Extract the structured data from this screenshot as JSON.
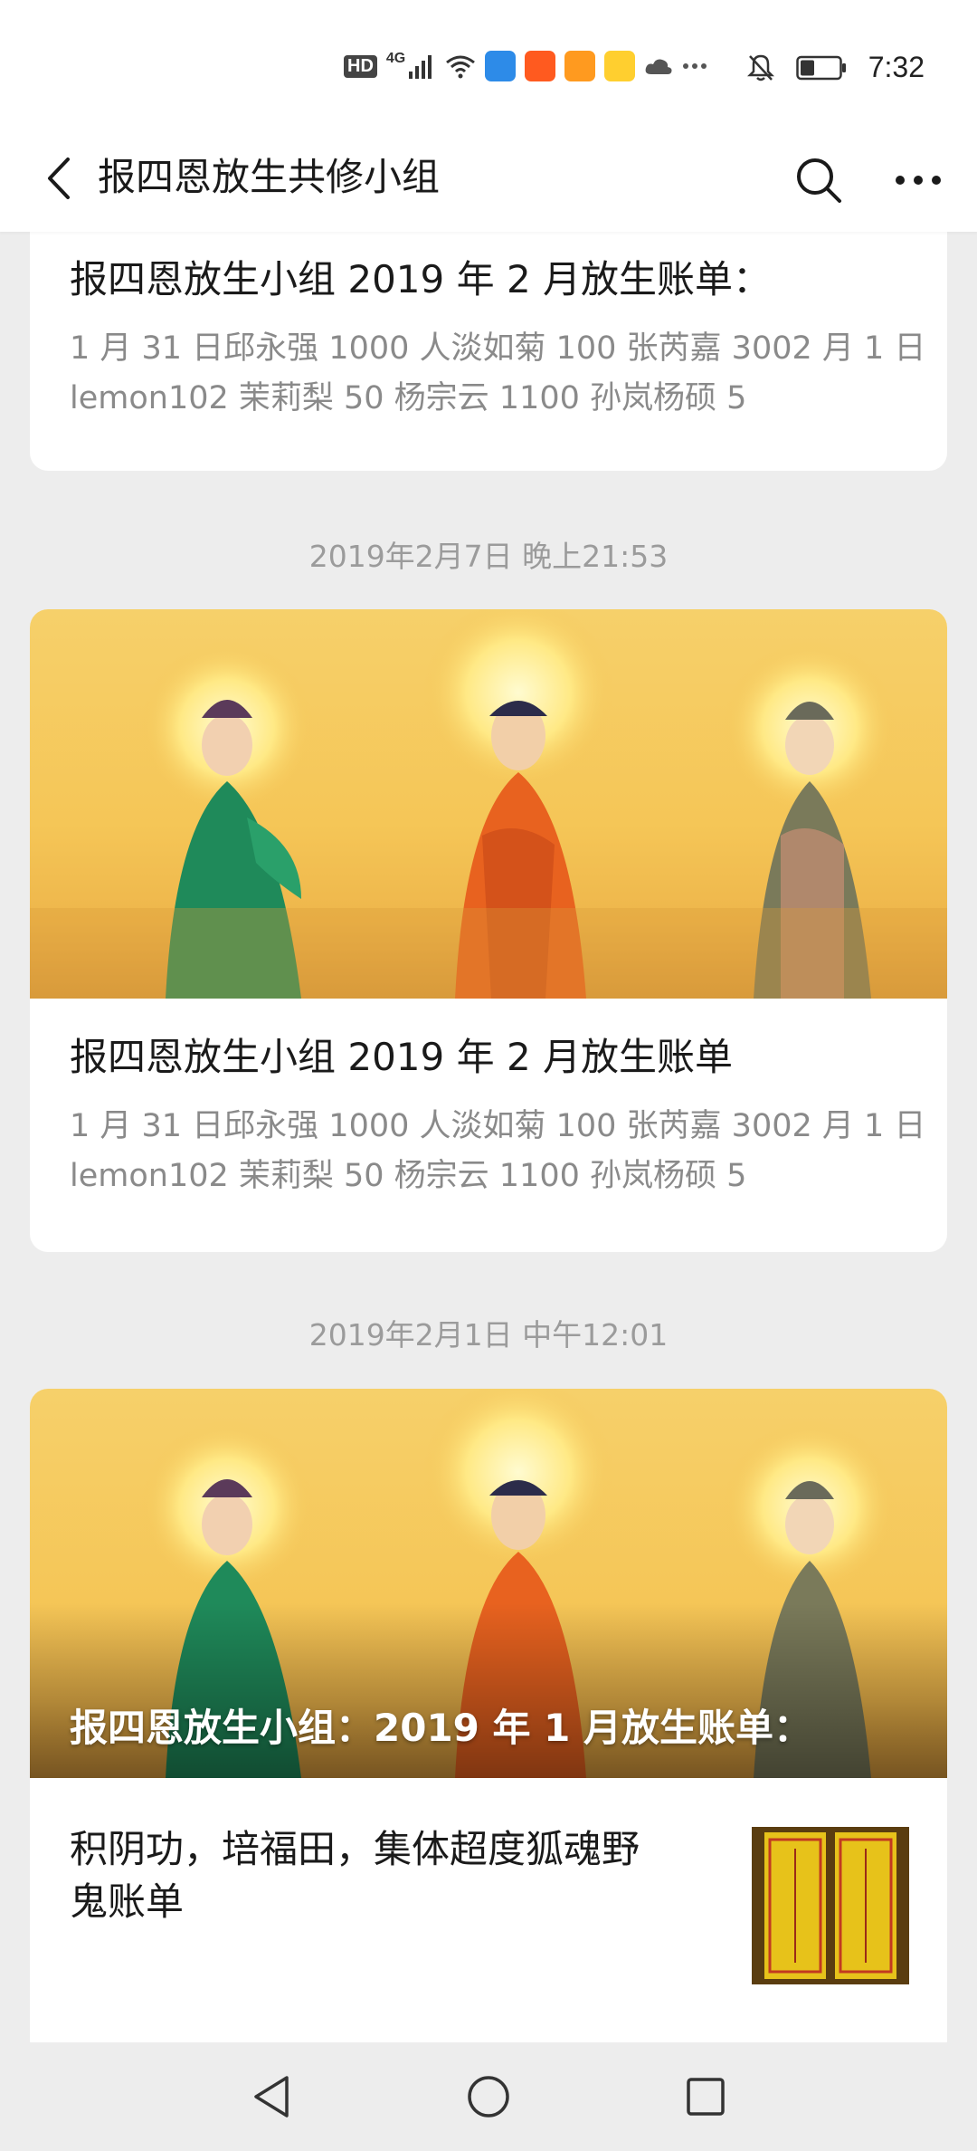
{
  "status_bar": {
    "time": "7:32",
    "network_label": "HD",
    "network_type": "4G",
    "icons": [
      "signal-icon",
      "wifi-icon",
      "app-icon",
      "taobao-icon",
      "app-icon",
      "app-icon",
      "cloud-icon",
      "more-dots-icon"
    ],
    "right_icons": [
      "bell-muted-icon",
      "battery-icon"
    ]
  },
  "header": {
    "title": "报四恩放生共修小组",
    "back_icon": "chevron-left-icon",
    "search_icon": "search-icon",
    "more_icon": "more-dots-icon"
  },
  "messages": [
    {
      "title": "报四恩放生小组 2019 年 2 月放生账单：",
      "desc_line1": "1 月 31 日邱永强 1000 人淡如菊 100 张芮嘉 3002 月 1 日",
      "desc_line2": "lemon102 茉莉梨 50 杨宗云 1100 孙岚杨硕 5"
    },
    {
      "timestamp": "2019年2月7日 晚上21:53",
      "title": "报四恩放生小组 2019 年 2 月放生账单",
      "desc_line1": "1 月 31 日邱永强 1000 人淡如菊 100 张芮嘉 3002 月 1 日",
      "desc_line2": "lemon102 茉莉梨 50 杨宗云 1100 孙岚杨硕 5"
    },
    {
      "timestamp": "2019年2月1日 中午12:01",
      "cover_title": "报四恩放生小组：2019 年 1 月放生账单：",
      "sub_title_line1": "积阴功，培福田，集体超度狐魂野",
      "sub_title_line2": "鬼账单"
    }
  ],
  "nav_bar": {
    "back_icon": "triangle-back-icon",
    "home_icon": "circle-home-icon",
    "recents_icon": "square-recents-icon"
  },
  "colors": {
    "background": "#ededed",
    "card": "#ffffff",
    "gray_text": "#8a8a8a",
    "cover_gold": "#f5c657"
  }
}
